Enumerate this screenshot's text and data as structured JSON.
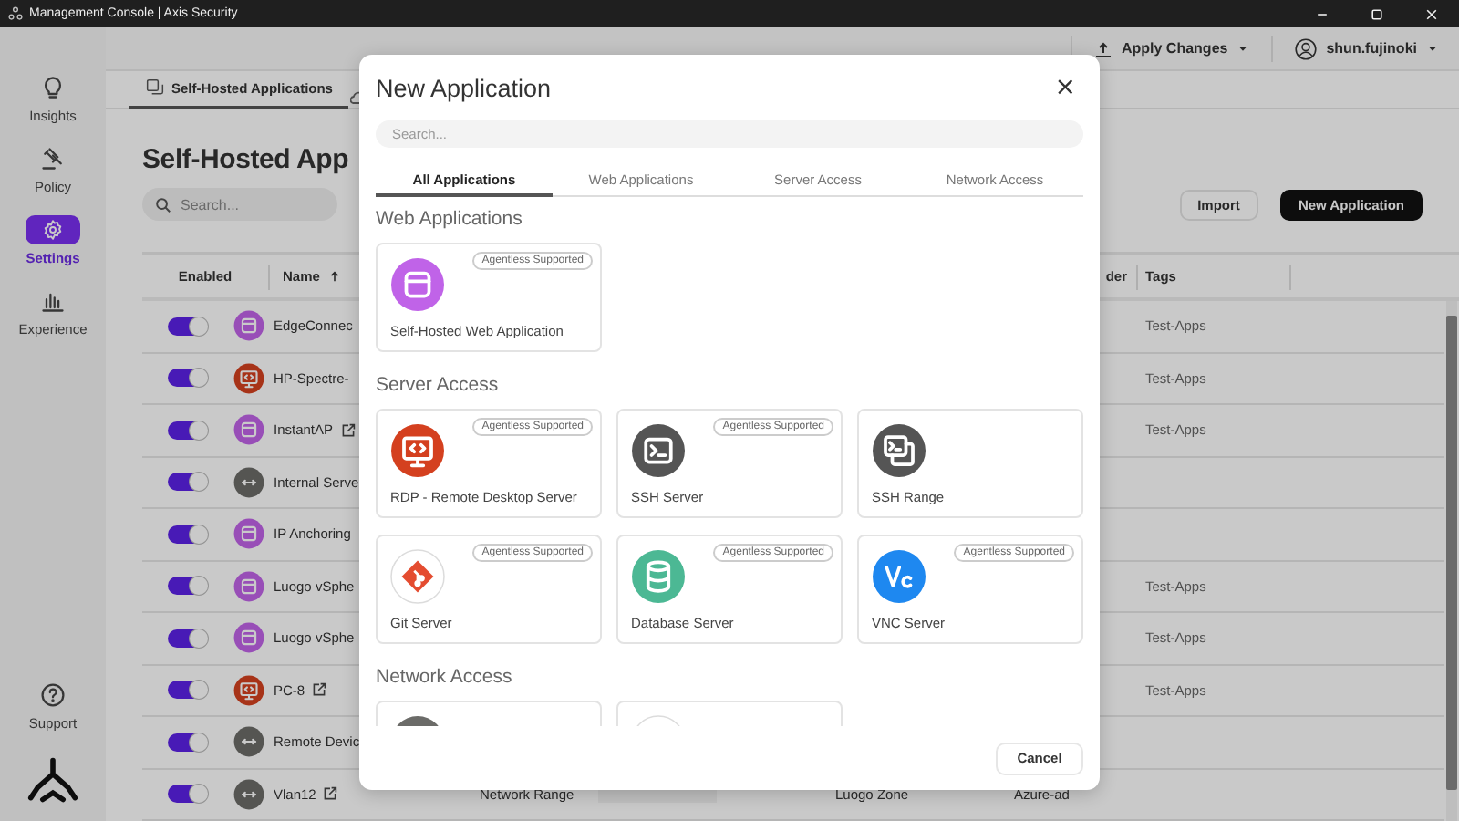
{
  "window": {
    "title": "Management Console | Axis Security"
  },
  "sidebar": {
    "items": [
      {
        "label": "Insights",
        "selected": false
      },
      {
        "label": "Policy",
        "selected": false
      },
      {
        "label": "Settings",
        "selected": true
      },
      {
        "label": "Experience",
        "selected": false
      }
    ],
    "footer": [
      {
        "label": "Support",
        "selected": false
      }
    ]
  },
  "topbar": {
    "apply": "Apply Changes",
    "user": "shun.fujinoki"
  },
  "page": {
    "tabs": [
      {
        "label": "Self-Hosted Applications",
        "selected": true
      }
    ],
    "heading": "Self-Hosted App",
    "search": {
      "placeholder": "Search..."
    },
    "buttons": [
      {
        "label": "Import",
        "kind": "secondary"
      },
      {
        "label": "New Application",
        "kind": "primary"
      }
    ]
  },
  "table": {
    "columns": [
      {
        "label": "Enabled",
        "sorted": false
      },
      {
        "label": "Name",
        "sorted": true
      },
      {
        "label": "der",
        "sorted": false
      },
      {
        "label": "Tags",
        "sorted": false
      }
    ],
    "rows": [
      {
        "enabled": true,
        "kind": "web",
        "name": "EdgeConnec",
        "external": false,
        "tags": "Test-Apps"
      },
      {
        "enabled": true,
        "kind": "rdp",
        "name": "HP-Spectre-",
        "external": false,
        "tags": "Test-Apps"
      },
      {
        "enabled": true,
        "kind": "web",
        "name": "InstantAP",
        "external": true,
        "tags": "Test-Apps"
      },
      {
        "enabled": true,
        "kind": "network",
        "name": "Internal Serve",
        "external": false
      },
      {
        "enabled": true,
        "kind": "web",
        "name": "IP Anchoring",
        "external": false
      },
      {
        "enabled": true,
        "kind": "web",
        "name": "Luogo vSphe",
        "external": false,
        "tags": "Test-Apps"
      },
      {
        "enabled": true,
        "kind": "web",
        "name": "Luogo vSphe",
        "external": false,
        "tags": "Test-Apps"
      },
      {
        "enabled": true,
        "kind": "rdp",
        "name": "PC-8",
        "external": true,
        "tags": "Test-Apps"
      },
      {
        "enabled": true,
        "kind": "network",
        "name": "Remote Devic",
        "external": false
      },
      {
        "enabled": true,
        "kind": "network",
        "name": "Vlan12",
        "external": true,
        "type": "Network Range",
        "zone": "Luogo Zone",
        "provider": "Azure-ad"
      }
    ]
  },
  "dialog": {
    "title": "New Application",
    "close": "×",
    "search": {
      "placeholder": "Search..."
    },
    "tabs": [
      {
        "label": "All Applications",
        "selected": true
      },
      {
        "label": "Web Applications",
        "selected": false
      },
      {
        "label": "Server Access",
        "selected": false
      },
      {
        "label": "Network Access",
        "selected": false
      }
    ],
    "sections": [
      {
        "title": "Web Applications",
        "cards": [
          {
            "kind": "web",
            "label": "Self-Hosted Web Application",
            "badge": "Agentless Supported"
          }
        ]
      },
      {
        "title": "Server Access",
        "cards": [
          {
            "kind": "rdp",
            "label": "RDP - Remote Desktop Server",
            "badge": "Agentless Supported"
          },
          {
            "kind": "terminal",
            "label": "SSH Server",
            "badge": "Agentless Supported"
          },
          {
            "kind": "terminal-range",
            "label": "SSH Range"
          },
          {
            "kind": "git",
            "label": "Git Server",
            "badge": "Agentless Supported"
          },
          {
            "kind": "database",
            "label": "Database Server",
            "badge": "Agentless Supported"
          },
          {
            "kind": "vnc",
            "label": "VNC Server",
            "badge": "Agentless Supported"
          }
        ]
      },
      {
        "title": "Network Access",
        "cards": [
          {
            "kind": "network"
          },
          {
            "kind": "cloud"
          }
        ]
      }
    ],
    "buttons": [
      {
        "label": "Cancel"
      }
    ]
  }
}
